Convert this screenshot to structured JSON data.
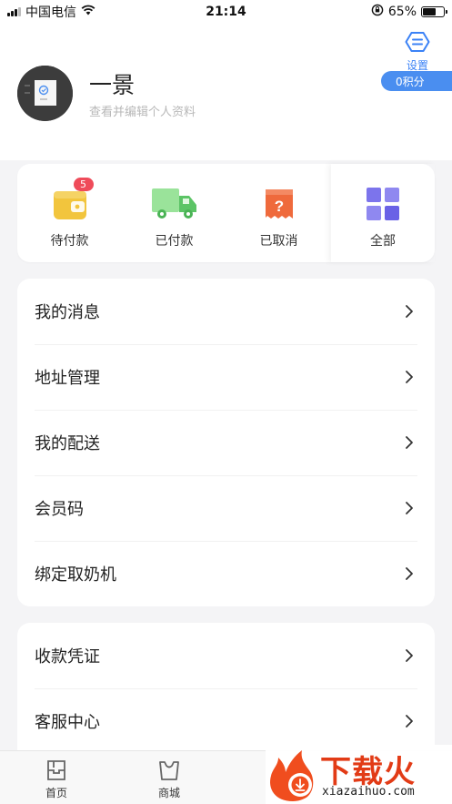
{
  "status_bar": {
    "carrier": "中国电信",
    "time": "21:14",
    "battery": "65%",
    "battery_level": 0.65,
    "icons": [
      "signal-icon",
      "wifi-icon",
      "orientation-lock-icon",
      "battery-icon"
    ]
  },
  "header": {
    "settings_label": "设置",
    "points": "0积分",
    "username": "一景",
    "profile_hint": "查看并编辑个人资料"
  },
  "orders": [
    {
      "label": "待付款",
      "icon": "wallet-icon",
      "badge": "5",
      "color": "#f2c53d"
    },
    {
      "label": "已付款",
      "icon": "truck-icon",
      "color": "#7cd680"
    },
    {
      "label": "已取消",
      "icon": "cancel-receipt-icon",
      "color": "#ef6a3c"
    },
    {
      "label": "全部",
      "icon": "grid-icon",
      "color": "#7c74ec"
    }
  ],
  "menu_primary": [
    {
      "label": "我的消息"
    },
    {
      "label": "地址管理"
    },
    {
      "label": "我的配送"
    },
    {
      "label": "会员码"
    },
    {
      "label": "绑定取奶机"
    }
  ],
  "menu_secondary": [
    {
      "label": "收款凭证"
    },
    {
      "label": "客服中心"
    }
  ],
  "bottom_nav": [
    {
      "label": "首页",
      "icon": "home-icon"
    },
    {
      "label": "商城",
      "icon": "shopping-bag-icon"
    }
  ],
  "watermark": {
    "text_cn": "下载火",
    "text_en": "xiazaihuo.com"
  },
  "colors": {
    "accent": "#3b82f6",
    "points_badge": "#4a8ef0",
    "badge_red": "#ef4b5a",
    "background": "#f4f4f6"
  }
}
